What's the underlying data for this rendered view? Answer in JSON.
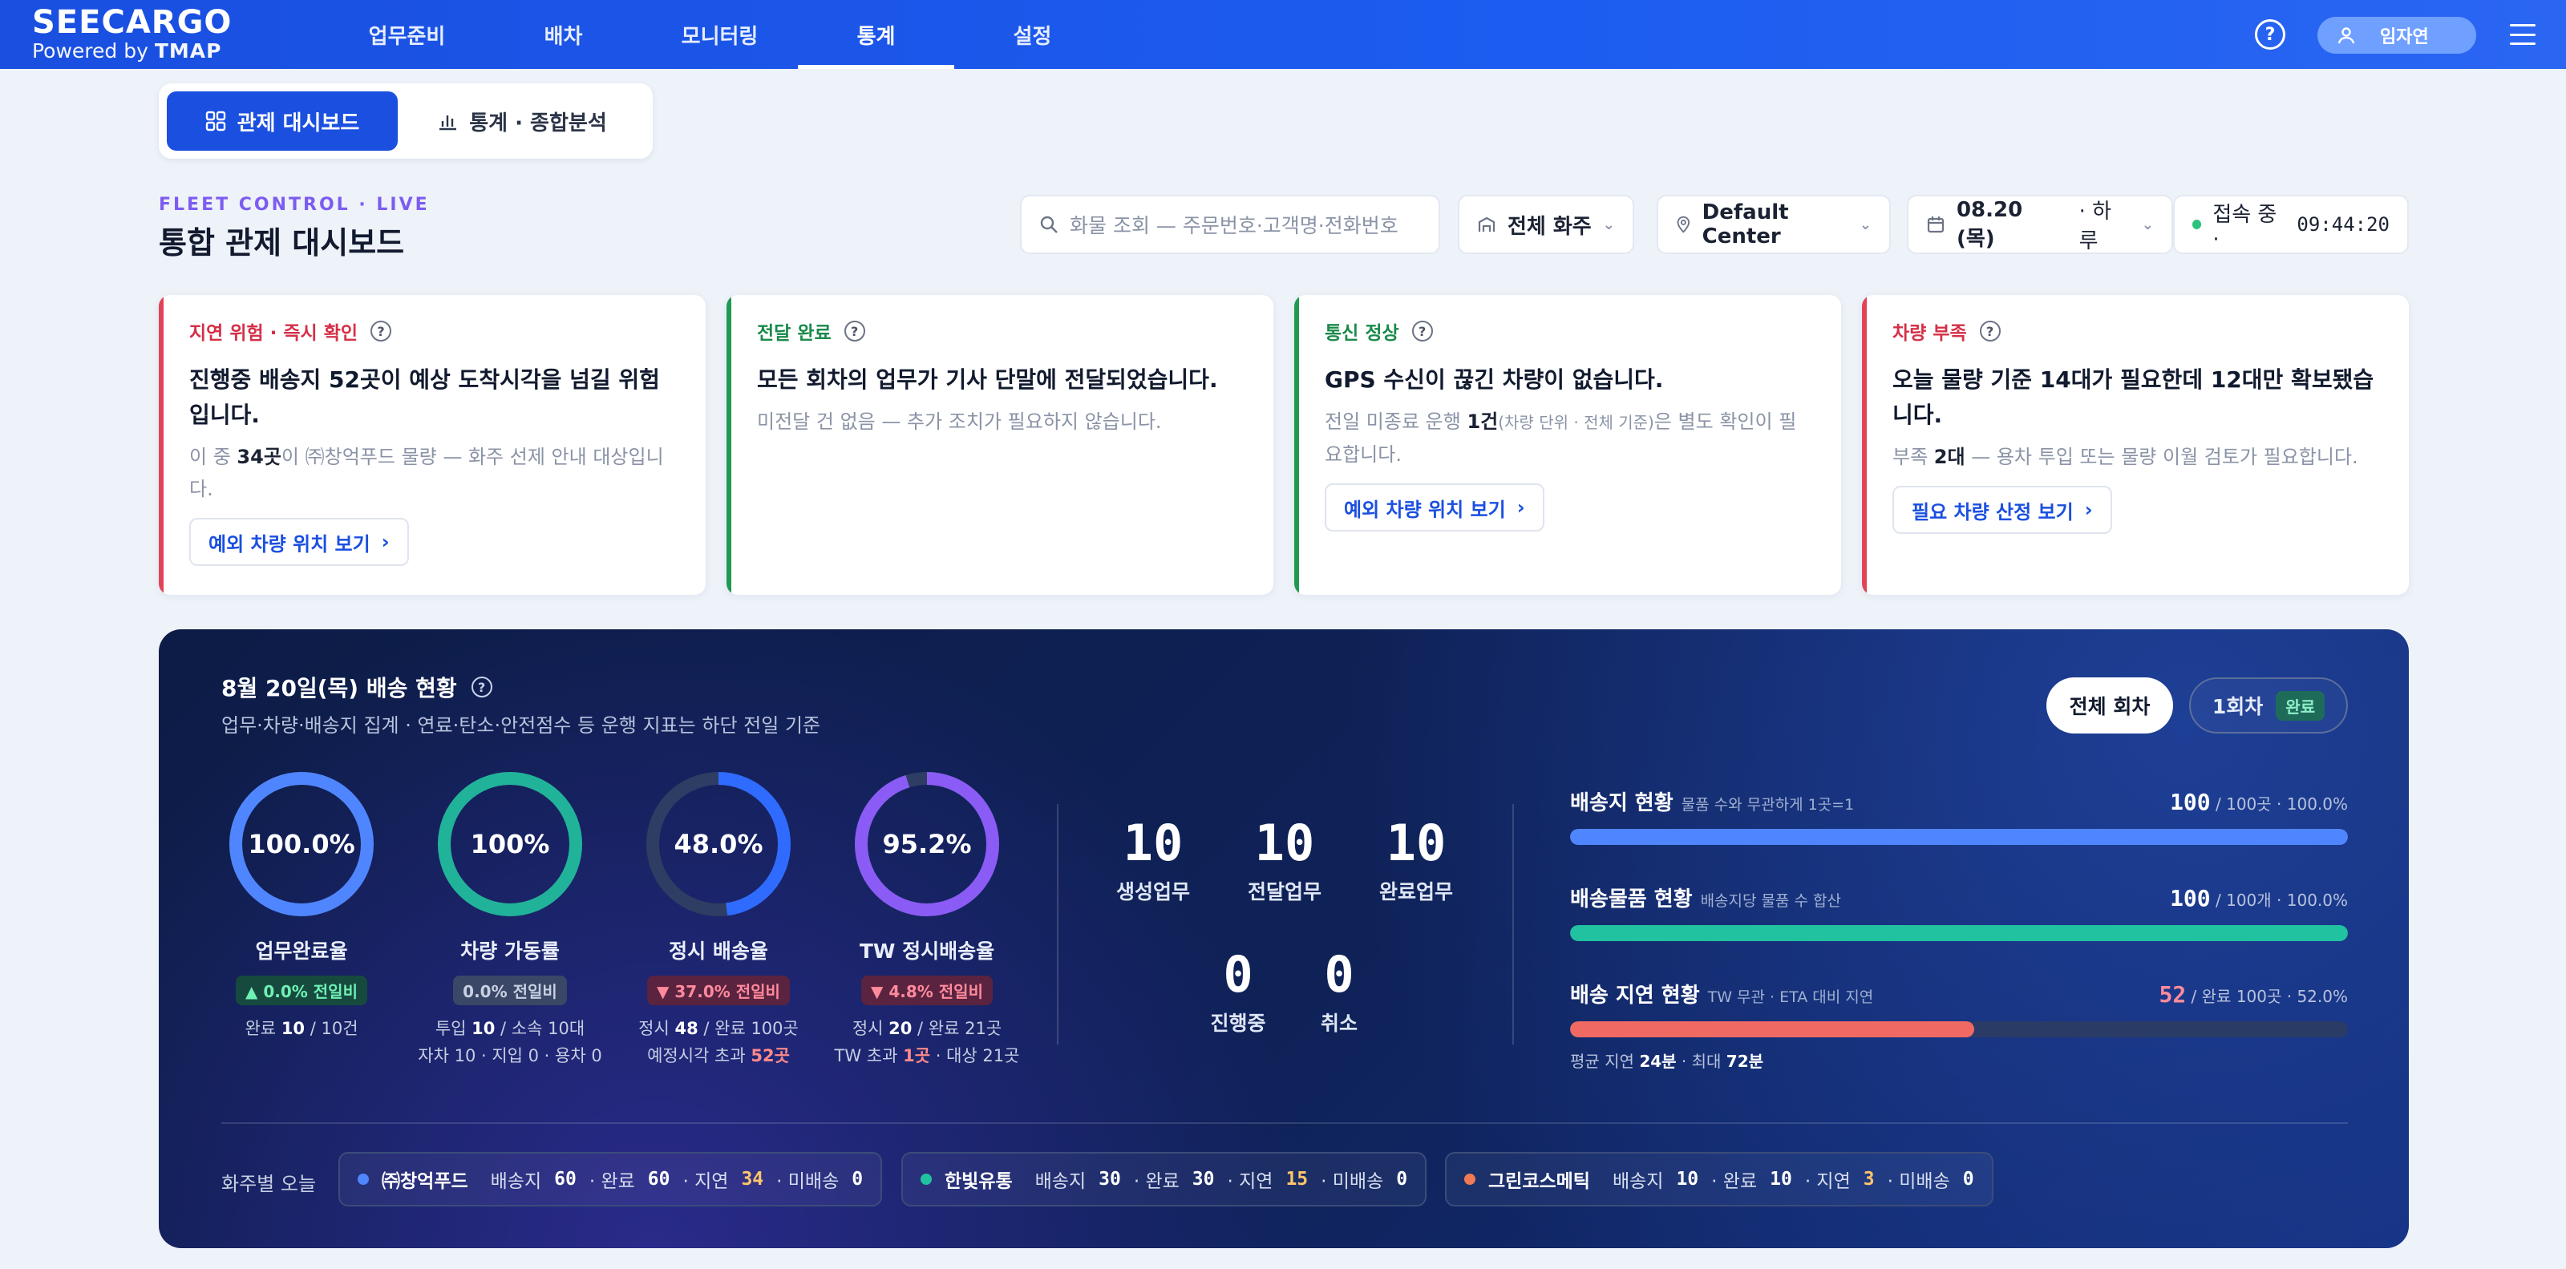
{
  "header": {
    "brand": "SEECARGO",
    "powered_prefix": "Powered by",
    "powered_brand": "TMAP",
    "nav": [
      "업무준비",
      "배차",
      "모니터링",
      "통계",
      "설정"
    ],
    "help": "?",
    "user": "임자연"
  },
  "tabs": {
    "dashboard": "관제 대시보드",
    "stats": "통계 · 종합분석"
  },
  "page": {
    "eyebrow": "FLEET CONTROL · LIVE",
    "title": "통합 관제 대시보드"
  },
  "filters": {
    "search_placeholder": "화물 조회 — 주문번호·고객명·전화번호",
    "shipper": "전체 화주",
    "center": "Default Center",
    "date": "08.20 (목)",
    "period": "· 하루",
    "status_label": "접속 중 ·",
    "time": "09:44:20"
  },
  "alerts": [
    {
      "tag": "지연 위험 · 즉시 확인",
      "headline": "진행중 배송지 52곳이 예상 도착시각을 넘길 위험입니다.",
      "desc_pre": "이 중 ",
      "desc_bold": "34곳",
      "desc_post": "이 ㈜창억푸드 물량 — 화주 선제 안내 대상입니다.",
      "action": "예외 차량 위치 보기"
    },
    {
      "tag": "전달 완료",
      "headline": "모든 회차의 업무가 기사 단말에 전달되었습니다.",
      "desc": "미전달 건 없음 — 추가 조치가 필요하지 않습니다."
    },
    {
      "tag": "통신 정상",
      "headline": "GPS 수신이 끊긴 차량이 없습니다.",
      "desc_pre": "전일 미종료 운행 ",
      "desc_bold": "1건",
      "desc_small": "(차량 단위 · 전체 기준)",
      "desc_post": "은 별도 확인이 필요합니다.",
      "action": "예외 차량 위치 보기"
    },
    {
      "tag": "차량 부족",
      "headline": "오늘 물량 기준 14대가 필요한데 12대만 확보됐습니다.",
      "desc_pre": "부족 ",
      "desc_bold": "2대",
      "desc_post": " — 용차 투입 또는 물량 이월 검토가 필요합니다.",
      "action": "필요 차량 산정 보기"
    }
  ],
  "panel": {
    "title": "8월 20일(목) 배송 현황",
    "subtitle": "업무·차량·배송지 집계 · 연료·탄소·안전점수 등 운행 지표는 하단 전일 기준",
    "btn_all": "전체 회차",
    "btn_one": "1회차",
    "btn_one_badge": "완료",
    "kpis": [
      {
        "value": "100.0%",
        "pct": 100,
        "color": "#4f86ff",
        "label": "업무완료율",
        "change": "▲ 0.0% 전일비",
        "change_type": "up",
        "foot1_pre": "완료 ",
        "foot1_b": "10",
        "foot1_post": " / 10건"
      },
      {
        "value": "100%",
        "pct": 100,
        "color": "#21b39a",
        "label": "차량 가동률",
        "change": "0.0% 전일비",
        "change_type": "neutral",
        "foot1_pre": "투입 ",
        "foot1_b": "10",
        "foot1_post": " / 소속 10대",
        "foot2": "자차 10 · 지입 0 · 용차 0"
      },
      {
        "value": "48.0%",
        "pct": 48,
        "color": "#2f6bff",
        "label": "정시 배송율",
        "change": "▼ 37.0% 전일비",
        "change_type": "down",
        "foot1_pre": "정시 ",
        "foot1_b": "48",
        "foot1_post": " / 완료 100곳",
        "foot2_pre": "예정시각 초과 ",
        "foot2_hl": "52곳"
      },
      {
        "value": "95.2%",
        "pct": 95.2,
        "color": "#8a5cf5",
        "label": "TW 정시배송율",
        "change": "▼ 4.8% 전일비",
        "change_type": "down",
        "foot1_pre": "정시 ",
        "foot1_b": "20",
        "foot1_post": " / 완료 21곳",
        "foot2_pre": "TW 초과 ",
        "foot2_hl": "1곳",
        "foot2_post": " · 대상 21곳"
      }
    ],
    "counts": [
      {
        "num": "10",
        "label": "생성업무"
      },
      {
        "num": "10",
        "label": "전달업무"
      },
      {
        "num": "10",
        "label": "완료업무"
      },
      {
        "num": "0",
        "label": "진행중"
      },
      {
        "num": "0",
        "label": "취소"
      }
    ],
    "metrics": [
      {
        "title": "배송지 현황",
        "sub": "물품 수와 무관하게 1곳=1",
        "num": "100",
        "rest": " / 100곳 · 100.0%",
        "pct": 100,
        "color": "#4f86ff"
      },
      {
        "title": "배송물품 현황",
        "sub": "배송지당 물품 수 합산",
        "num": "100",
        "rest": " / 100개 · 100.0%",
        "pct": 100,
        "color": "#21c29f"
      },
      {
        "title": "배송 지연 현황",
        "sub": "TW 무관 · ETA 대비 지연",
        "num": "52",
        "rest": " / 완료 100곳 · 52.0%",
        "pct": 52,
        "color": "#f06a63",
        "note_pre": "평균 지연 ",
        "note_b1": "24분",
        "note_mid": " · 최대 ",
        "note_b2": "72분"
      }
    ],
    "shipper_label": "화주별 오늘",
    "shippers": [
      {
        "name": "㈜창억푸드",
        "color": "#4f86ff",
        "dest": "60",
        "done": "60",
        "late": "34",
        "undeliv": "0"
      },
      {
        "name": "한빛유통",
        "color": "#21c29f",
        "dest": "30",
        "done": "30",
        "late": "15",
        "undeliv": "0"
      },
      {
        "name": "그린코스메틱",
        "color": "#f07a55",
        "dest": "10",
        "done": "10",
        "late": "3",
        "undeliv": "0"
      }
    ],
    "ship_words": {
      "dest": "배송지",
      "done": "· 완료",
      "late": "· 지연",
      "undeliv": "· 미배송"
    }
  }
}
